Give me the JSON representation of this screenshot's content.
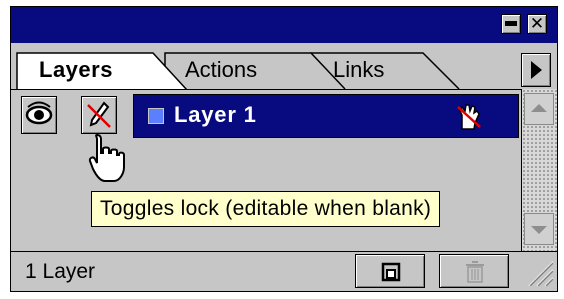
{
  "window": {
    "minimize_icon": "minimize-icon",
    "close_icon": "close-icon",
    "close_glyph": "✕"
  },
  "tabs": [
    {
      "label": "Layers",
      "active": true
    },
    {
      "label": "Actions",
      "active": false
    },
    {
      "label": "Links",
      "active": false
    }
  ],
  "palette_menu_icon": "triangle-right-icon",
  "layers": [
    {
      "name": "Layer 1",
      "color": "#5b7fff",
      "visible": true,
      "locked": false,
      "selected": true
    }
  ],
  "tooltip": {
    "text": "Toggles lock (editable when blank)"
  },
  "footer": {
    "layer_count": "1 Layer",
    "new_layer_icon": "new-layer-icon",
    "delete_icon": "trash-icon"
  },
  "colors": {
    "title_bar": "#080b80",
    "selected_row": "#080b80",
    "panel": "#c6c6c6",
    "tooltip_bg": "#ffffcc"
  }
}
